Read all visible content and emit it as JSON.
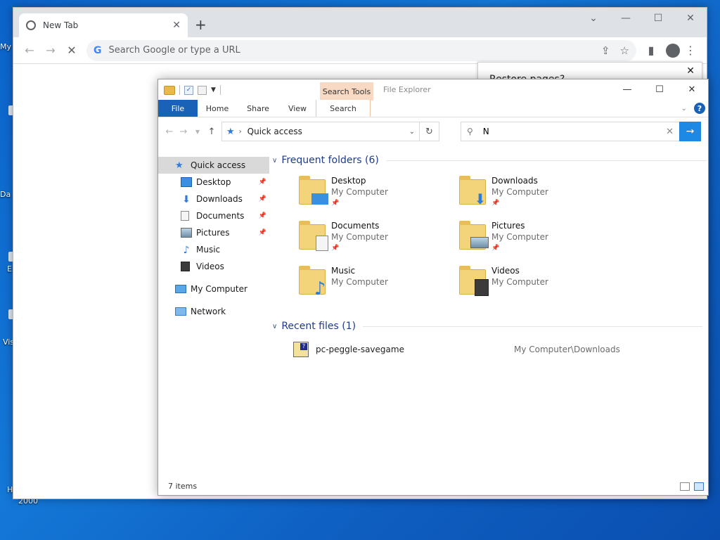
{
  "desktop": {
    "labels": [
      "My",
      "Da",
      "E",
      "Vis",
      "H",
      "2000"
    ]
  },
  "chrome": {
    "tab_title": "New Tab",
    "new_tab_symbol": "+",
    "omnibox_placeholder": "Search Google or type a URL",
    "google_glyph": "G",
    "restore_prompt": "Restore pages?"
  },
  "explorer": {
    "app_title": "File Explorer",
    "context_tab_label": "Search Tools",
    "ribbon_tabs": [
      {
        "label": "File"
      },
      {
        "label": "Home"
      },
      {
        "label": "Share"
      },
      {
        "label": "View"
      },
      {
        "label": "Search"
      }
    ],
    "address": "Quick access",
    "search_value": "N",
    "nav": [
      {
        "label": "Quick access"
      },
      {
        "label": "Desktop"
      },
      {
        "label": "Downloads"
      },
      {
        "label": "Documents"
      },
      {
        "label": "Pictures"
      },
      {
        "label": "Music"
      },
      {
        "label": "Videos"
      },
      {
        "label": "My Computer"
      },
      {
        "label": "Network"
      }
    ],
    "frequent_header": "Frequent folders (6)",
    "folders": [
      {
        "name": "Desktop",
        "location": "My Computer"
      },
      {
        "name": "Downloads",
        "location": "My Computer"
      },
      {
        "name": "Documents",
        "location": "My Computer"
      },
      {
        "name": "Pictures",
        "location": "My Computer"
      },
      {
        "name": "Music",
        "location": "My Computer"
      },
      {
        "name": "Videos",
        "location": "My Computer"
      }
    ],
    "recent_header": "Recent files (1)",
    "recent": [
      {
        "name": "pc-peggle-savegame",
        "path": "My Computer\\Downloads"
      }
    ],
    "status": "7 items",
    "help_glyph": "?"
  },
  "colors": {
    "accent": "#1a62b8",
    "search_tools": "#f8d9c4",
    "desktop_bg": "#0b63c9"
  }
}
